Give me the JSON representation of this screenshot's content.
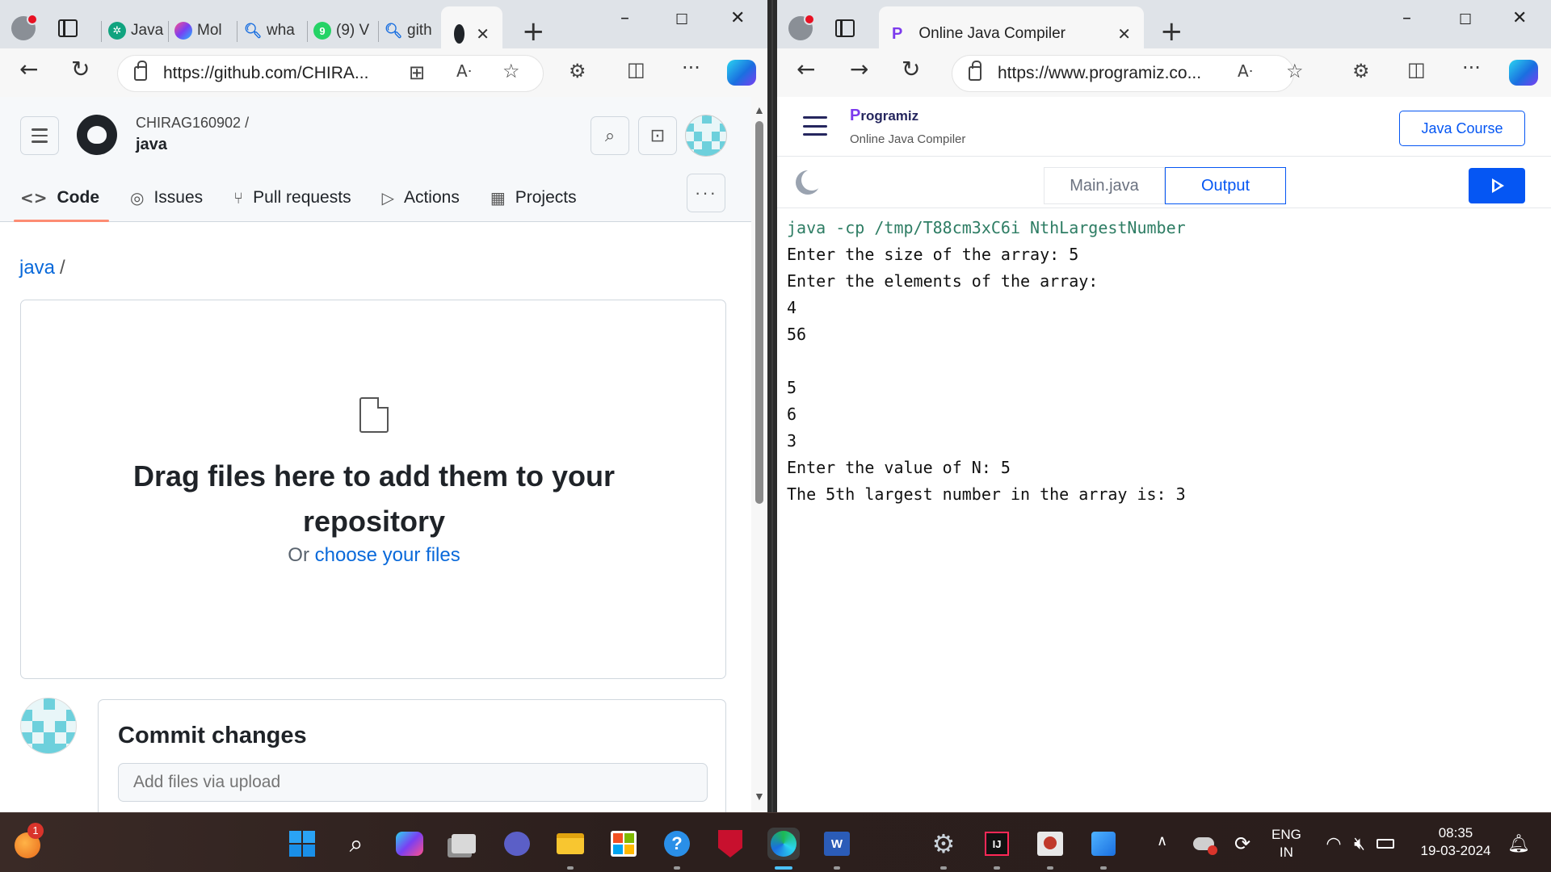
{
  "left_browser": {
    "tabs": [
      {
        "label": "Java",
        "icon": "chatgpt-icon",
        "color": "#10a37f"
      },
      {
        "label": "Mol",
        "icon": "copilot-swirl-icon",
        "color": "#c03aff"
      },
      {
        "label": "wha",
        "icon": "bing-search-icon",
        "color": "#1a6fe0"
      },
      {
        "label": "(9) V",
        "icon": "whatsapp-icon",
        "color": "#25d366"
      },
      {
        "label": "gith",
        "icon": "bing-search-icon",
        "color": "#1a6fe0"
      }
    ],
    "url": "https://github.com/CHIRA...",
    "github": {
      "owner": "CHIRAG160902 /",
      "repo": "java",
      "nav_tabs": [
        {
          "label": "Code",
          "icon": "<>"
        },
        {
          "label": "Issues",
          "icon": "◎"
        },
        {
          "label": "Pull requests",
          "icon": "⑂"
        },
        {
          "label": "Actions",
          "icon": "▷"
        },
        {
          "label": "Projects",
          "icon": "▦"
        }
      ],
      "breadcrumb_repo": "java",
      "breadcrumb_sep": "/",
      "drop_title": "Drag files here to add them to your repository",
      "drop_or": "Or",
      "drop_link": "choose your files",
      "commit_title": "Commit changes",
      "commit_placeholder": "Add files via upload"
    }
  },
  "right_browser": {
    "tab_title": "Online Java Compiler",
    "url": "https://www.programiz.co...",
    "programiz": {
      "logo": "rogramiz",
      "logo_p": "P",
      "subtitle": "Online Java Compiler",
      "course_button": "Java Course",
      "file_tab": "Main.java",
      "output_tab": "Output",
      "output_command": "java -cp /tmp/T88cm3xC6i NthLargestNumber",
      "output_lines": [
        "Enter the size of the array: 5",
        "Enter the elements of the array:",
        "4",
        "56",
        "",
        "5",
        "6",
        "3",
        "Enter the value of N: 5",
        "The 5th largest number in the array is: 3"
      ]
    }
  },
  "taskbar": {
    "notification_badge": "1",
    "language": "ENG",
    "region": "IN",
    "time": "08:35",
    "date": "19-03-2024",
    "colors": {
      "accent": "#4cc2ff"
    }
  }
}
